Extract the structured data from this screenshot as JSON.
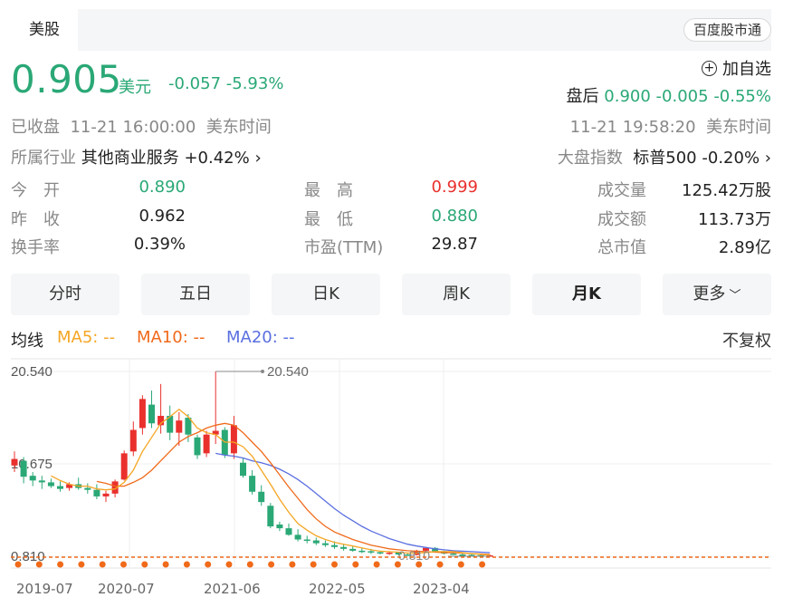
{
  "header": {
    "tab_label": "美股",
    "badge": "百度股市通"
  },
  "quote": {
    "price": "0.905",
    "unit": "美元",
    "change": "-0.057",
    "change_pct": "-5.93%",
    "add_watchlist": "加自选",
    "after_label": "盘后",
    "after_price": "0.900",
    "after_change": "-0.005",
    "after_pct": "-0.55%",
    "status": "已收盘",
    "close_time": "11-21 16:00:00",
    "tz": "美东时间",
    "after_time": "11-21 19:58:20",
    "after_tz": "美东时间",
    "industry_label": "所属行业",
    "industry_name": "其他商业服务",
    "industry_chg": "+0.42%",
    "index_label": "大盘指数",
    "index_name": "标普500",
    "index_chg": "-0.20%"
  },
  "stats": [
    {
      "label": "今　开",
      "value": "0.890",
      "color": "#2aa876"
    },
    {
      "label": "昨　收",
      "value": "0.962",
      "color": "#222222"
    },
    {
      "label": "换手率",
      "value": "0.39%",
      "color": "#222222"
    },
    {
      "label": "最　高",
      "value": "0.999",
      "color": "#e9302d"
    },
    {
      "label": "最　低",
      "value": "0.880",
      "color": "#2aa876"
    },
    {
      "label": "市盈(TTM)",
      "value": "29.87",
      "color": "#222222"
    },
    {
      "label": "成交量",
      "value": "125.42万股",
      "color": "#222222"
    },
    {
      "label": "成交额",
      "value": "113.73万",
      "color": "#222222"
    },
    {
      "label": "总市值",
      "value": "2.89亿",
      "color": "#222222"
    }
  ],
  "tabs": [
    "分时",
    "五日",
    "日K",
    "周K",
    "月K",
    "更多"
  ],
  "active_tab": "月K",
  "ma": {
    "label": "均线",
    "ma5": "MA5: --",
    "ma10": "MA10: --",
    "ma20": "MA20: --",
    "adjust": "不复权"
  },
  "colors": {
    "up": "#e9302d",
    "down": "#2aa876",
    "ma5": "#f5a623",
    "ma10": "#f06a1a",
    "ma20": "#5b6fe0",
    "dotted": "#f06a1a"
  },
  "chart_data": {
    "type": "candlestick",
    "y_labels": [
      "20.540",
      "10.675",
      "0.810"
    ],
    "x_labels": [
      "2019-07",
      "2020-07",
      "2021-06",
      "2022-05",
      "2023-04"
    ],
    "max_marker": "20.540",
    "min_marker": "0.810",
    "y_range": [
      0.81,
      20.54
    ],
    "candles": [
      [
        10.5,
        12,
        9.8,
        11.2
      ],
      [
        11,
        11.4,
        8.6,
        9.3
      ],
      [
        9.4,
        9.8,
        8.3,
        8.9
      ],
      [
        8.9,
        9.4,
        8.0,
        8.7
      ],
      [
        8.7,
        9.1,
        8.1,
        8.3
      ],
      [
        8.3,
        8.8,
        7.7,
        8.0
      ],
      [
        8.1,
        8.7,
        7.8,
        8.5
      ],
      [
        8.5,
        9.2,
        7.9,
        8.1
      ],
      [
        8.1,
        8.6,
        7.5,
        7.9
      ],
      [
        7.9,
        8.5,
        6.9,
        7.2
      ],
      [
        7.2,
        7.8,
        6.6,
        7.5
      ],
      [
        7.5,
        9.0,
        7.1,
        8.8
      ],
      [
        9.0,
        12.1,
        8.9,
        11.8
      ],
      [
        12.0,
        15.2,
        11.5,
        14.3
      ],
      [
        14.5,
        18.0,
        13.8,
        17.6
      ],
      [
        17.0,
        18.5,
        14.5,
        15.0
      ],
      [
        14.8,
        19.2,
        13.9,
        15.8
      ],
      [
        15.8,
        16.9,
        13.2,
        14.0
      ],
      [
        14.0,
        16.2,
        12.6,
        15.3
      ],
      [
        15.6,
        16.0,
        13.0,
        13.8
      ],
      [
        13.5,
        13.8,
        11.2,
        11.6
      ],
      [
        11.8,
        14.2,
        11.4,
        13.8
      ],
      [
        13.8,
        20.54,
        12.8,
        14.2
      ],
      [
        14.3,
        14.6,
        11.3,
        11.6
      ],
      [
        11.8,
        15.8,
        11.2,
        14.8
      ],
      [
        10.8,
        11.3,
        9.2,
        9.4
      ],
      [
        9.4,
        10.0,
        7.4,
        7.7
      ],
      [
        7.7,
        8.4,
        6.2,
        6.6
      ],
      [
        6.2,
        6.5,
        3.8,
        4.0
      ],
      [
        4.2,
        4.5,
        3.5,
        3.8
      ],
      [
        3.8,
        4.3,
        3.0,
        3.1
      ],
      [
        3.1,
        3.7,
        2.4,
        2.6
      ],
      [
        2.6,
        3.0,
        2.2,
        2.5
      ],
      [
        2.5,
        2.8,
        2.0,
        2.2
      ],
      [
        2.2,
        2.5,
        1.8,
        2.0
      ],
      [
        2.0,
        2.4,
        1.6,
        1.8
      ],
      [
        1.8,
        2.1,
        1.4,
        1.6
      ],
      [
        1.6,
        1.9,
        1.3,
        1.4
      ],
      [
        1.4,
        1.7,
        1.15,
        1.35
      ],
      [
        1.35,
        1.6,
        1.05,
        1.25
      ],
      [
        1.25,
        1.4,
        1.0,
        1.1
      ],
      [
        1.1,
        1.35,
        0.95,
        1.2
      ],
      [
        1.2,
        1.3,
        0.9,
        1.0
      ],
      [
        1.0,
        1.15,
        0.88,
        0.95
      ],
      [
        0.95,
        1.5,
        0.92,
        1.4
      ],
      [
        1.4,
        1.8,
        1.2,
        1.7
      ],
      [
        1.7,
        1.8,
        1.3,
        1.35
      ],
      [
        1.35,
        1.4,
        1.0,
        1.1
      ],
      [
        1.1,
        1.2,
        0.95,
        1.0
      ],
      [
        1.0,
        1.1,
        0.9,
        0.96
      ],
      [
        0.96,
        1.05,
        0.88,
        0.92
      ],
      [
        0.92,
        1.0,
        0.85,
        0.89
      ],
      [
        0.89,
        0.999,
        0.81,
        0.905
      ]
    ],
    "ma5": [
      null,
      null,
      null,
      null,
      9.4,
      8.9,
      8.5,
      8.3,
      8.3,
      8.0,
      7.9,
      8.0,
      8.7,
      10.0,
      12.0,
      13.5,
      15.0,
      15.7,
      16.5,
      15.7,
      14.5,
      14.0,
      13.8,
      13.0,
      13.0,
      12.5,
      11.5,
      10.0,
      8.5,
      6.9,
      5.5,
      4.3,
      3.6,
      3.0,
      2.6,
      2.3,
      2.1,
      1.9,
      1.7,
      1.5,
      1.35,
      1.3,
      1.25,
      1.15,
      1.15,
      1.2,
      1.3,
      1.3,
      1.3,
      1.2,
      1.1,
      1.0,
      0.95
    ],
    "ma10": [
      null,
      null,
      null,
      null,
      null,
      null,
      null,
      null,
      null,
      8.8,
      8.6,
      8.3,
      8.3,
      8.7,
      9.2,
      10.0,
      11.0,
      12.0,
      13.0,
      13.6,
      14.0,
      14.5,
      14.8,
      15.0,
      14.8,
      14.0,
      13.0,
      12.0,
      10.8,
      9.5,
      8.2,
      7.0,
      5.8,
      4.8,
      4.0,
      3.4,
      3.0,
      2.6,
      2.3,
      2.0,
      1.8,
      1.6,
      1.5,
      1.4,
      1.35,
      1.3,
      1.25,
      1.2,
      1.2,
      1.15,
      1.1,
      1.05,
      1.0
    ],
    "ma20": [
      null,
      null,
      null,
      null,
      null,
      null,
      null,
      null,
      null,
      null,
      null,
      null,
      null,
      null,
      null,
      null,
      null,
      null,
      null,
      null,
      null,
      null,
      11.8,
      11.6,
      11.5,
      11.3,
      11.0,
      10.8,
      10.5,
      10.1,
      9.6,
      9.0,
      8.3,
      7.5,
      6.7,
      5.9,
      5.2,
      4.6,
      4.0,
      3.5,
      3.1,
      2.7,
      2.4,
      2.1,
      1.9,
      1.75,
      1.6,
      1.5,
      1.4,
      1.35,
      1.3,
      1.25,
      1.2
    ],
    "bottom_dots": 23
  }
}
